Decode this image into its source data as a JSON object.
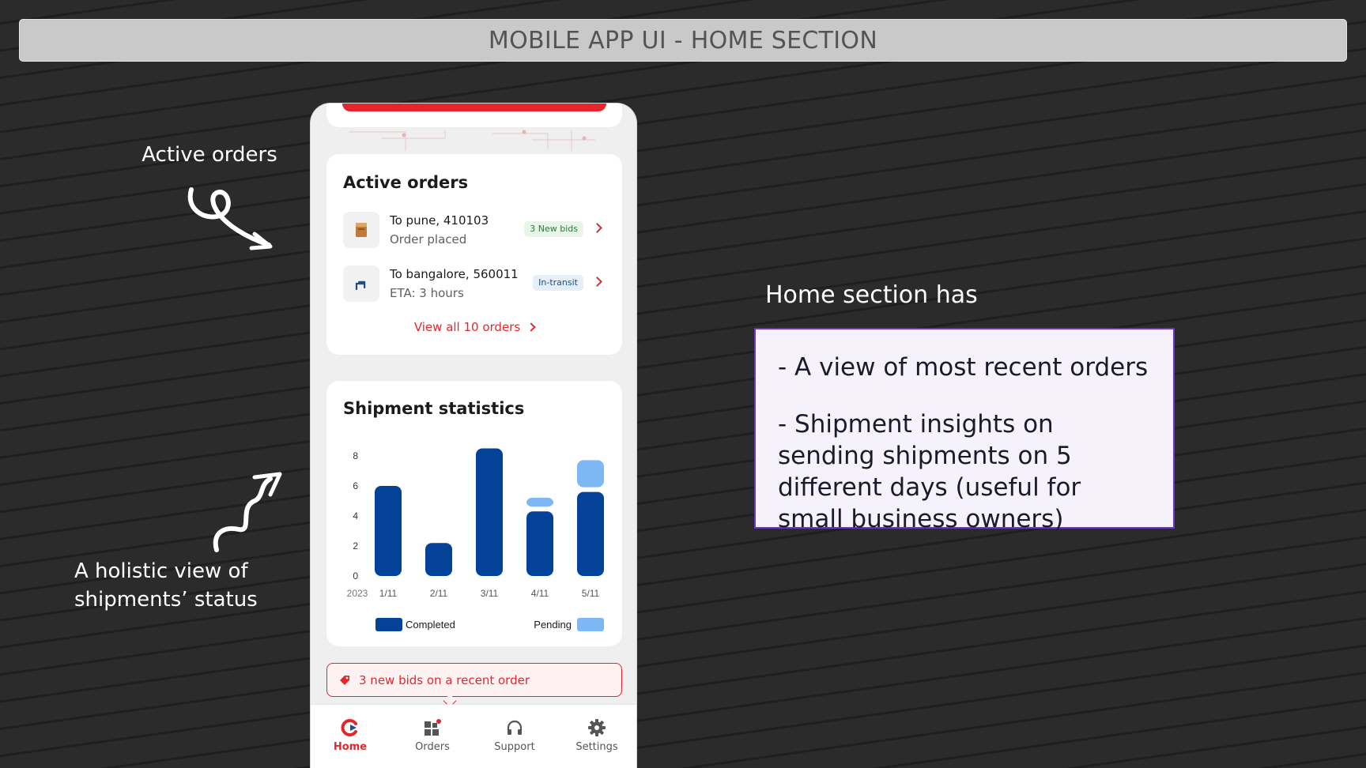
{
  "banner": {
    "title": "MOBILE APP UI - HOME SECTION"
  },
  "annotations": {
    "active_orders": "Active orders",
    "holistic_line1": "A holistic view of",
    "holistic_line2": "shipments’ status"
  },
  "home_section": {
    "heading": "Home section has",
    "points": [
      "- A view of most recent orders",
      "- Shipment insights on sending shipments on 5 different days (useful for small business owners)"
    ]
  },
  "app": {
    "accent_color": "#e5272d",
    "active_orders": {
      "title": "Active orders",
      "orders": [
        {
          "destination": "To pune, 410103",
          "status": "Order placed",
          "badge": "3 New bids",
          "icon": "package-icon"
        },
        {
          "destination": "To bangalore, 560011",
          "status": "ETA: 3 hours",
          "badge": "In-transit",
          "icon": "route-arrow-icon"
        }
      ],
      "view_all": "View all 10 orders"
    },
    "stats": {
      "title": "Shipment statistics"
    },
    "alert": {
      "text": "3 new bids on a recent order",
      "icon": "tag-icon"
    },
    "nav": [
      {
        "label": "Home",
        "icon": "home-logo-icon",
        "active": true
      },
      {
        "label": "Orders",
        "icon": "orders-grid-icon",
        "active": false
      },
      {
        "label": "Support",
        "icon": "headphones-icon",
        "active": false
      },
      {
        "label": "Settings",
        "icon": "gear-icon",
        "active": false
      }
    ]
  },
  "chart_data": {
    "type": "bar",
    "title": "Shipment statistics",
    "year_label": "2023",
    "categories": [
      "1/11",
      "2/11",
      "3/11",
      "4/11",
      "5/11"
    ],
    "series": [
      {
        "name": "Completed",
        "values": [
          6,
          2.2,
          8.5,
          4.3,
          5.6
        ],
        "color": "#034296"
      },
      {
        "name": "Pending",
        "values": [
          0,
          0,
          0,
          0.6,
          1.8
        ],
        "color": "#7db7f4"
      }
    ],
    "y_ticks": [
      0,
      2,
      4,
      6,
      8
    ],
    "ylim": [
      0,
      9
    ],
    "stacked": true,
    "grid": false,
    "legend": "bottom"
  }
}
